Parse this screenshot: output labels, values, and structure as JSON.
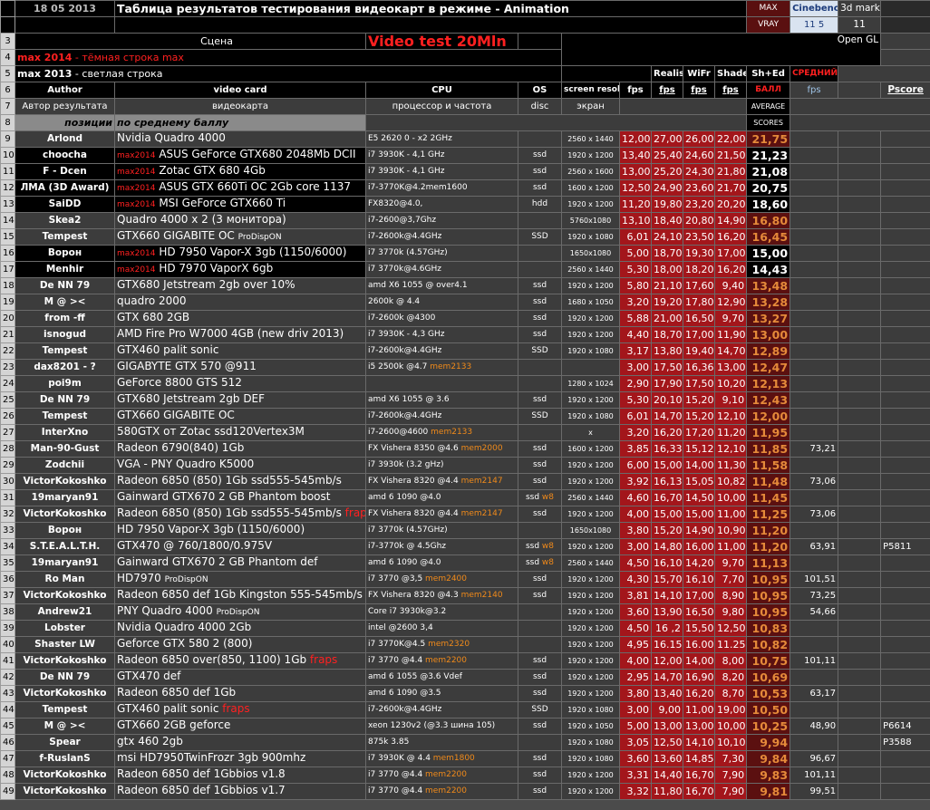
{
  "header": {
    "date": "18 05  2013",
    "title": "Таблица результатов тестирования видеокарт в режиме - Animation",
    "max_vray": [
      "MAX",
      "VRAY"
    ],
    "cinebench": [
      "Cinebench",
      "11 5"
    ],
    "mark3d": [
      "3d mark",
      "11"
    ],
    "scene": "Сцена",
    "video_test": "Video test 20Mln",
    "opengl": "Open GL",
    "legend_max2014_a": "max 2014",
    "legend_max2014_b": " - тёмная строка max",
    "legend_max2013_a": "max 2013",
    "legend_max2013_b": " - светлая строка",
    "avg_score_1": "СРЕДНИЙ",
    "avg_score_2": "БАЛЛ",
    "realistic": "Realistic",
    "wifr": "WiFr",
    "shaded": "Shaded",
    "shed": "Sh+Ed",
    "author": "Author",
    "videocard": "video card",
    "cpu": "CPU",
    "os": "OS",
    "screen_res": "screen resolut",
    "fps": "fps",
    "average": "AVERAGE",
    "fps_col": "fps",
    "pscore": "Pscore",
    "author_ru": "Автор результата",
    "videocard_ru": "видеокарта",
    "cpu_ru": "процессор и частота",
    "disc": "disc",
    "screen_ru": "экран",
    "scores": "SCORES",
    "pos_label": "позиции",
    "pos_sort": "по среднему баллу"
  },
  "rows": [
    {
      "n": "9",
      "author": "Arlond",
      "tag": "",
      "card": "Nvidia Quadro 4000",
      "card_extra": "",
      "cpu": "E5 2620 0 - x2 2GHz",
      "cpu_extra": "",
      "os": "",
      "os_extra": "",
      "res": "2560 x 1440",
      "r": "12,00",
      "w": "27,00",
      "s": "26,00",
      "e": "22,00",
      "avg": "21,75",
      "dark": false,
      "vr": "",
      "cb": "",
      "mk": ""
    },
    {
      "n": "10",
      "author": "choocha",
      "tag": "max2014",
      "card": " ASUS GeForce GTX680 2048Mb DCII",
      "card_extra": "",
      "cpu": "i7 3930K - 4,1 GHz",
      "cpu_extra": "",
      "os": "ssd",
      "os_extra": "",
      "res": "1920 x 1200",
      "r": "13,40",
      "w": "25,40",
      "s": "24,60",
      "e": "21,50",
      "avg": "21,23",
      "dark": true,
      "vr": "",
      "cb": "",
      "mk": ""
    },
    {
      "n": "11",
      "author": "F - Dcen",
      "tag": "max2014",
      "card": " Zotac GTX 680 4Gb",
      "card_extra": "",
      "cpu": "i7 3930K - 4,1 GHz",
      "cpu_extra": "",
      "os": "ssd",
      "os_extra": "",
      "res": "2560 x 1600",
      "r": "13,00",
      "w": "25,20",
      "s": "24,30",
      "e": "21,80",
      "avg": "21,08",
      "dark": true,
      "vr": "",
      "cb": "",
      "mk": ""
    },
    {
      "n": "12",
      "author": "ЛМА (3D Award)",
      "tag": "max2014",
      "card": " ASUS GTX 660Ti OC 2Gb core 1137",
      "card_extra": "",
      "cpu": "i7-3770K@4.2mem1600",
      "cpu_extra": "",
      "os": "ssd",
      "os_extra": "",
      "res": "1600 x 1200",
      "r": "12,50",
      "w": "24,90",
      "s": "23,60",
      "e": "21,70",
      "avg": "20,75",
      "dark": true,
      "vr": "",
      "cb": "",
      "mk": ""
    },
    {
      "n": "13",
      "author": "SaiDD",
      "tag": "max2014",
      "card": " MSI GeForce GTX660 Ti",
      "card_extra": "",
      "cpu": "FX8320@4.0,",
      "cpu_extra": "",
      "os": "hdd",
      "os_extra": "",
      "res": "1920 x 1200",
      "r": "11,20",
      "w": "19,80",
      "s": "23,20",
      "e": "20,20",
      "avg": "18,60",
      "dark": true,
      "vr": "",
      "cb": "",
      "mk": ""
    },
    {
      "n": "14",
      "author": "Skea2",
      "tag": "",
      "card": "Quadro 4000 x 2 (3 монитора)",
      "card_extra": "",
      "cpu": "i7-2600@3,7Ghz",
      "cpu_extra": "",
      "os": "",
      "os_extra": "",
      "res": "5760x1080",
      "r": "13,10",
      "w": "18,40",
      "s": "20,80",
      "e": "14,90",
      "avg": "16,80",
      "dark": false,
      "vr": "",
      "cb": "",
      "mk": ""
    },
    {
      "n": "15",
      "author": "Tempest",
      "tag": "",
      "card": "GTX660 GIGABITE OC ",
      "card_extra": "ProDispON",
      "cpu": "i7-2600k@4.4GHz",
      "cpu_extra": "",
      "os": "SSD",
      "os_extra": "",
      "res": "1920 x 1080",
      "r": "6,01",
      "w": "24,10",
      "s": "23,50",
      "e": "16,20",
      "avg": "16,45",
      "dark": false,
      "vr": "",
      "cb": "",
      "mk": ""
    },
    {
      "n": "16",
      "author": "Ворон",
      "tag": "max2014",
      "card": " HD 7950 Vapor-X 3gb (1150/6000)",
      "card_extra": "",
      "cpu": "i7 3770k (4.57GHz)",
      "cpu_extra": "",
      "os": "",
      "os_extra": "",
      "res": "1650x1080",
      "r": "5,00",
      "w": "18,70",
      "s": "19,30",
      "e": "17,00",
      "avg": "15,00",
      "dark": true,
      "vr": "",
      "cb": "",
      "mk": ""
    },
    {
      "n": "17",
      "author": "Menhir",
      "tag": "max2014",
      "card": " HD 7970 VaporX 6gb",
      "card_extra": "",
      "cpu": "i7 3770k@4.6GHz",
      "cpu_extra": "",
      "os": "",
      "os_extra": "",
      "res": "2560 x 1440",
      "r": "5,30",
      "w": "18,00",
      "s": "18,20",
      "e": "16,20",
      "avg": "14,43",
      "dark": true,
      "vr": "",
      "cb": "",
      "mk": ""
    },
    {
      "n": "18",
      "author": "De NN 79",
      "tag": "",
      "card": "GTX680 Jetstream 2gb over 10%",
      "card_extra": "",
      "cpu": "amd X6 1055 @ over4.1",
      "cpu_extra": "",
      "os": "ssd",
      "os_extra": "",
      "res": "1920 x 1200",
      "r": "5,80",
      "w": "21,10",
      "s": "17,60",
      "e": "9,40",
      "avg": "13,48",
      "dark": false,
      "vr": "",
      "cb": "",
      "mk": ""
    },
    {
      "n": "19",
      "author": "M @ ><",
      "tag": "",
      "card": "quadro 2000",
      "card_extra": "",
      "cpu": "2600k @ 4.4",
      "cpu_extra": "",
      "os": "ssd",
      "os_extra": "",
      "res": "1680 x 1050",
      "r": "3,20",
      "w": "19,20",
      "s": "17,80",
      "e": "12,90",
      "avg": "13,28",
      "dark": false,
      "vr": "",
      "cb": "",
      "mk": ""
    },
    {
      "n": "20",
      "author": "from -ff",
      "tag": "",
      "card": "GTX 680 2GB",
      "card_extra": "",
      "cpu": "i7-2600k @4300",
      "cpu_extra": "",
      "os": "ssd",
      "os_extra": "",
      "res": "1920 x 1200",
      "r": "5,88",
      "w": "21,00",
      "s": "16,50",
      "e": "9,70",
      "avg": "13,27",
      "dark": false,
      "vr": "",
      "cb": "",
      "mk": ""
    },
    {
      "n": "21",
      "author": "isnogud",
      "tag": "",
      "card": "AMD Fire Pro W7000 4GB (new driv 2013)",
      "card_extra": "",
      "cpu": "i7 3930K - 4,3 GHz",
      "cpu_extra": "",
      "os": "ssd",
      "os_extra": "",
      "res": "1920 x 1200",
      "r": "4,40",
      "w": "18,70",
      "s": "17,00",
      "e": "11,90",
      "avg": "13,00",
      "dark": false,
      "vr": "",
      "cb": "",
      "mk": ""
    },
    {
      "n": "22",
      "author": "Tempest",
      "tag": "",
      "card": "GTX460 palit sonic",
      "card_extra": "",
      "cpu": "i7-2600k@4.4GHz",
      "cpu_extra": "",
      "os": "SSD",
      "os_extra": "",
      "res": "1920 x 1080",
      "r": "3,17",
      "w": "13,80",
      "s": "19,40",
      "e": "14,70",
      "avg": "12,89",
      "dark": false,
      "vr": "",
      "cb": "",
      "mk": ""
    },
    {
      "n": "23",
      "author": "dax8201 - ?",
      "tag": "",
      "card": "GIGABYTE GTX 570 @911",
      "card_extra": "",
      "cpu": "i5 2500k @4.7 ",
      "cpu_extra": "mem2133",
      "os": "",
      "os_extra": "",
      "res": "",
      "r": "3,00",
      "w": "17,50",
      "s": "16,36",
      "e": "13,00",
      "avg": "12,47",
      "dark": false,
      "vr": "",
      "cb": "",
      "mk": ""
    },
    {
      "n": "24",
      "author": "poi9m",
      "tag": "",
      "card": "GeForce 8800 GTS 512",
      "card_extra": "",
      "cpu": "",
      "cpu_extra": "",
      "os": "",
      "os_extra": "",
      "res": "1280 x 1024",
      "r": "2,90",
      "w": "17,90",
      "s": "17,50",
      "e": "10,20",
      "avg": "12,13",
      "dark": false,
      "vr": "",
      "cb": "",
      "mk": ""
    },
    {
      "n": "25",
      "author": "De NN 79",
      "tag": "",
      "card": "GTX680 Jetstream 2gb DEF",
      "card_extra": "",
      "cpu": "amd X6 1055 @ 3.6",
      "cpu_extra": "",
      "os": "ssd",
      "os_extra": "",
      "res": "1920 x 1200",
      "r": "5,30",
      "w": "20,10",
      "s": "15,20",
      "e": "9,10",
      "avg": "12,43",
      "dark": false,
      "vr": "",
      "cb": "",
      "mk": ""
    },
    {
      "n": "26",
      "author": "Tempest",
      "tag": "",
      "card": "GTX660 GIGABITE OC",
      "card_extra": "",
      "cpu": "i7-2600k@4.4GHz",
      "cpu_extra": "",
      "os": "SSD",
      "os_extra": "",
      "res": "1920 x 1080",
      "r": "6,01",
      "w": "14,70",
      "s": "15,20",
      "e": "12,10",
      "avg": "12,00",
      "dark": false,
      "vr": "",
      "cb": "",
      "mk": ""
    },
    {
      "n": "27",
      "author": "InterXno",
      "tag": "",
      "card": "580GTX от Zotac     ssd120Vertex3M",
      "card_extra": "",
      "cpu": "i7-2600@4600 ",
      "cpu_extra": "mem2133",
      "os": "",
      "os_extra": "",
      "res": "x",
      "r": "3,20",
      "w": "16,20",
      "s": "17,20",
      "e": "11,20",
      "avg": "11,95",
      "dark": false,
      "vr": "",
      "cb": "",
      "mk": ""
    },
    {
      "n": "28",
      "author": "Man-90-Gust",
      "tag": "",
      "card": "Radeon 6790(840)  1Gb",
      "card_extra": "",
      "cpu": "FX Vishera  8350 @4.6 ",
      "cpu_extra": "mem2000",
      "os": "ssd",
      "os_extra": "",
      "res": "1600 x 1200",
      "r": "3,85",
      "w": "16,33",
      "s": "15,12",
      "e": "12,10",
      "avg": "11,85",
      "dark": false,
      "vr": "73,21",
      "cb": "",
      "mk": ""
    },
    {
      "n": "29",
      "author": "Zodchii",
      "tag": "",
      "card": "VGA - PNY Quadro K5000",
      "card_extra": "",
      "cpu": "i7 3930k (3.2 gHz)",
      "cpu_extra": "",
      "os": "ssd",
      "os_extra": "",
      "res": "1920 x 1200",
      "r": "6,00",
      "w": "15,00",
      "s": "14,00",
      "e": "11,30",
      "avg": "11,58",
      "dark": false,
      "vr": "",
      "cb": "",
      "mk": ""
    },
    {
      "n": "30",
      "author": "VictorKokoshko",
      "tag": "",
      "card": "Radeon 6850 (850)  1Gb   ssd555-545mb/s",
      "card_extra": "",
      "cpu": "FX Vishera  8320 @4.4 ",
      "cpu_extra": "mem2147",
      "os": "ssd",
      "os_extra": "",
      "res": "1920 x 1200",
      "r": "3,92",
      "w": "16,13",
      "s": "15,05",
      "e": "10,82",
      "avg": "11,48",
      "dark": false,
      "vr": "73,06",
      "cb": "",
      "mk": ""
    },
    {
      "n": "31",
      "author": "19maryan91",
      "tag": "",
      "card": "Gainward GTX670 2 GB Phantom boost",
      "card_extra": "",
      "cpu": "amd 6  1090 @4.0",
      "cpu_extra": "",
      "os": "ssd ",
      "os_extra": "w8",
      "res": "2560 x 1440",
      "r": "4,60",
      "w": "16,70",
      "s": "14,50",
      "e": "10,00",
      "avg": "11,45",
      "dark": false,
      "vr": "",
      "cb": "",
      "mk": ""
    },
    {
      "n": "32",
      "author": "VictorKokoshko",
      "tag": "",
      "card": "Radeon 6850 (850)  1Gb   ssd555-545mb/s ",
      "card_extra": "fraps",
      "cpu": "FX Vishera  8320 @4.4 ",
      "cpu_extra": "mem2147",
      "os": "ssd",
      "os_extra": "",
      "res": "1920 x 1200",
      "r": "4,00",
      "w": "15,00",
      "s": "15,00",
      "e": "11,00",
      "avg": "11,25",
      "dark": false,
      "vr": "73,06",
      "cb": "",
      "mk": ""
    },
    {
      "n": "33",
      "author": "Ворон",
      "tag": "",
      "card": "HD 7950 Vapor-X 3gb (1150/6000)",
      "card_extra": "",
      "cpu": "i7 3770k (4.57GHz)",
      "cpu_extra": "",
      "os": "",
      "os_extra": "",
      "res": "1650x1080",
      "r": "3,80",
      "w": "15,20",
      "s": "14,90",
      "e": "10,90",
      "avg": "11,20",
      "dark": false,
      "vr": "",
      "cb": "",
      "mk": ""
    },
    {
      "n": "34",
      "author": "S.T.E.A.L.T.H.",
      "tag": "",
      "card": "GTX470 @ 760/1800/0.975V",
      "card_extra": "",
      "cpu": "i7-3770k @ 4.5Ghz",
      "cpu_extra": "",
      "os": "ssd ",
      "os_extra": "w8",
      "res": "1920 x 1200",
      "r": "3,00",
      "w": "14,80",
      "s": "16,00",
      "e": "11,00",
      "avg": "11,20",
      "dark": false,
      "vr": "63,91",
      "cb": "",
      "mk": "P5811"
    },
    {
      "n": "35",
      "author": "19maryan91",
      "tag": "",
      "card": "Gainward GTX670 2 GB Phantom def",
      "card_extra": "",
      "cpu": "amd 6  1090 @4.0",
      "cpu_extra": "",
      "os": "ssd ",
      "os_extra": "w8",
      "res": "2560 x 1440",
      "r": "4,50",
      "w": "16,10",
      "s": "14,20",
      "e": "9,70",
      "avg": "11,13",
      "dark": false,
      "vr": "",
      "cb": "",
      "mk": ""
    },
    {
      "n": "36",
      "author": "Ro Man",
      "tag": "",
      "card": "HD7970 ",
      "card_extra": "ProDispON",
      "cpu": "i7 3770 @3,5 ",
      "cpu_extra": "mem2400",
      "os": "ssd",
      "os_extra": "",
      "res": "1920 x 1200",
      "r": "4,30",
      "w": "15,70",
      "s": "16,10",
      "e": "7,70",
      "avg": "10,95",
      "dark": false,
      "vr": "101,51",
      "cb": "",
      "mk": ""
    },
    {
      "n": "37",
      "author": "VictorKokoshko",
      "tag": "",
      "card": "Radeon 6850 def  1Gb   Kingston 555-545mb/s",
      "card_extra": "",
      "cpu": "FX Vishera  8320 @4.3 ",
      "cpu_extra": "mem2140",
      "os": "ssd",
      "os_extra": "",
      "res": "1920 x 1200",
      "r": "3,81",
      "w": "14,10",
      "s": "17,00",
      "e": "8,90",
      "avg": "10,95",
      "dark": false,
      "vr": "73,25",
      "cb": "",
      "mk": ""
    },
    {
      "n": "38",
      "author": "Andrew21",
      "tag": "",
      "card": "PNY Quadro 4000 ",
      "card_extra": "ProDispON",
      "cpu": "Core i7 3930k@3.2",
      "cpu_extra": "",
      "os": "",
      "os_extra": "",
      "res": "1920 x 1200",
      "r": "3,60",
      "w": "13,90",
      "s": "16,50",
      "e": "9,80",
      "avg": "10,95",
      "dark": false,
      "vr": "54,66",
      "cb": "",
      "mk": ""
    },
    {
      "n": "39",
      "author": "Lobster",
      "tag": "",
      "card": "Nvidia Quadro 4000 2Gb",
      "card_extra": "",
      "cpu": "intel @2600 3,4",
      "cpu_extra": "",
      "os": "",
      "os_extra": "",
      "res": "1920 x 1200",
      "r": "4,50",
      "w": "16 ,2",
      "s": "15,50",
      "e": "12,50",
      "avg": "10,83",
      "dark": false,
      "vr": "",
      "cb": "",
      "mk": ""
    },
    {
      "n": "40",
      "author": "Shaster LW",
      "tag": "",
      "card": "Geforce GTX 580 2 (800)",
      "card_extra": "",
      "cpu": "i7 3770K@4.5 ",
      "cpu_extra": "mem2320",
      "os": "",
      "os_extra": "",
      "res": "1920 x 1200",
      "r": "4,95",
      "w": "16.15",
      "s": "16.00",
      "e": "11.25",
      "avg": "10,82",
      "dark": false,
      "vr": "",
      "cb": "",
      "mk": ""
    },
    {
      "n": "41",
      "author": "VictorKokoshko",
      "tag": "",
      "card": "Radeon 6850 over(850, 1100)  1Gb      ",
      "card_extra": "fraps",
      "cpu": "i7 3770 @4.4 ",
      "cpu_extra": "mem2200",
      "os": "ssd",
      "os_extra": "",
      "res": "1920 x 1200",
      "r": "4,00",
      "w": "12,00",
      "s": "14,00",
      "e": "8,00",
      "avg": "10,75",
      "dark": false,
      "vr": "101,11",
      "cb": "",
      "mk": ""
    },
    {
      "n": "42",
      "author": "De NN 79",
      "tag": "",
      "card": "GTX470 def",
      "card_extra": "",
      "cpu": "amd 6  1055 @3.6 Vdef",
      "cpu_extra": "",
      "os": "ssd",
      "os_extra": "",
      "res": "1920 x 1200",
      "r": "2,95",
      "w": "14,70",
      "s": "16,90",
      "e": "8,20",
      "avg": "10,69",
      "dark": false,
      "vr": "",
      "cb": "",
      "mk": ""
    },
    {
      "n": "43",
      "author": "VictorKokoshko",
      "tag": "",
      "card": "Radeon 6850 def  1Gb",
      "card_extra": "",
      "cpu": "amd 6  1090 @3.5",
      "cpu_extra": "",
      "os": "ssd",
      "os_extra": "",
      "res": "1920 x 1200",
      "r": "3,80",
      "w": "13,40",
      "s": "16,20",
      "e": "8,70",
      "avg": "10,53",
      "dark": false,
      "vr": "63,17",
      "cb": "",
      "mk": ""
    },
    {
      "n": "44",
      "author": "Tempest",
      "tag": "",
      "card": "GTX460 palit sonic      ",
      "card_extra": "fraps",
      "cpu": "i7-2600k@4.4GHz",
      "cpu_extra": "",
      "os": "SSD",
      "os_extra": "",
      "res": "1920 x 1080",
      "r": "3,00",
      "w": "9,00",
      "s": "11,00",
      "e": "19,00",
      "avg": "10,50",
      "dark": false,
      "vr": "",
      "cb": "",
      "mk": ""
    },
    {
      "n": "45",
      "author": "M @ ><",
      "tag": "",
      "card": "GTX660 2GB geforce",
      "card_extra": "",
      "cpu": "xeon 1230v2 (@3.3 шина 105)",
      "cpu_extra": "",
      "os": "ssd",
      "os_extra": "",
      "res": "1920 x 1050",
      "r": "5,00",
      "w": "13,00",
      "s": "13,00",
      "e": "10,00",
      "avg": "10,25",
      "dark": false,
      "vr": "48,90",
      "cb": "",
      "mk": "P6614"
    },
    {
      "n": "46",
      "author": "Spear",
      "tag": "",
      "card": "gtx 460 2gb",
      "card_extra": "",
      "cpu": "875k 3.85",
      "cpu_extra": "",
      "os": "",
      "os_extra": "",
      "res": "1920 x 1080",
      "r": "3,05",
      "w": "12,50",
      "s": "14,10",
      "e": "10,10",
      "avg": "9,94",
      "dark": false,
      "vr": "",
      "cb": "",
      "mk": "P3588"
    },
    {
      "n": "47",
      "author": "f-RuslanS",
      "tag": "",
      "card": "msi HD7950TwinFrozr  3gb 900mhz",
      "card_extra": "",
      "cpu": "i7 3930K @ 4.4 ",
      "cpu_extra": "mem1800",
      "os": "ssd",
      "os_extra": "",
      "res": "1920 x 1080",
      "r": "3,60",
      "w": "13,60",
      "s": "14,85",
      "e": "7,30",
      "avg": "9,84",
      "dark": false,
      "vr": "96,67",
      "cb": "",
      "mk": ""
    },
    {
      "n": "48",
      "author": "VictorKokoshko",
      "tag": "",
      "card": "Radeon 6850 def  1Gb",
      "card_extra": "bios v1.8",
      "cpu": "i7 3770 @4.4 ",
      "cpu_extra": "mem2200",
      "os": "ssd",
      "os_extra": "",
      "res": "1920 x 1200",
      "r": "3,31",
      "w": "14,40",
      "s": "16,70",
      "e": "7,90",
      "avg": "9,83",
      "dark": false,
      "vr": "101,11",
      "cb": "",
      "mk": ""
    },
    {
      "n": "49",
      "author": "VictorKokoshko",
      "tag": "",
      "card": "Radeon 6850 def  1Gb",
      "card_extra": "bios v1.7",
      "cpu": "i7 3770 @4.4 ",
      "cpu_extra": "mem2200",
      "os": "ssd",
      "os_extra": "",
      "res": "1920 x 1200",
      "r": "3,32",
      "w": "11,80",
      "s": "16,70",
      "e": "7,90",
      "avg": "9,81",
      "dark": false,
      "vr": "99,51",
      "cb": "",
      "mk": ""
    }
  ]
}
